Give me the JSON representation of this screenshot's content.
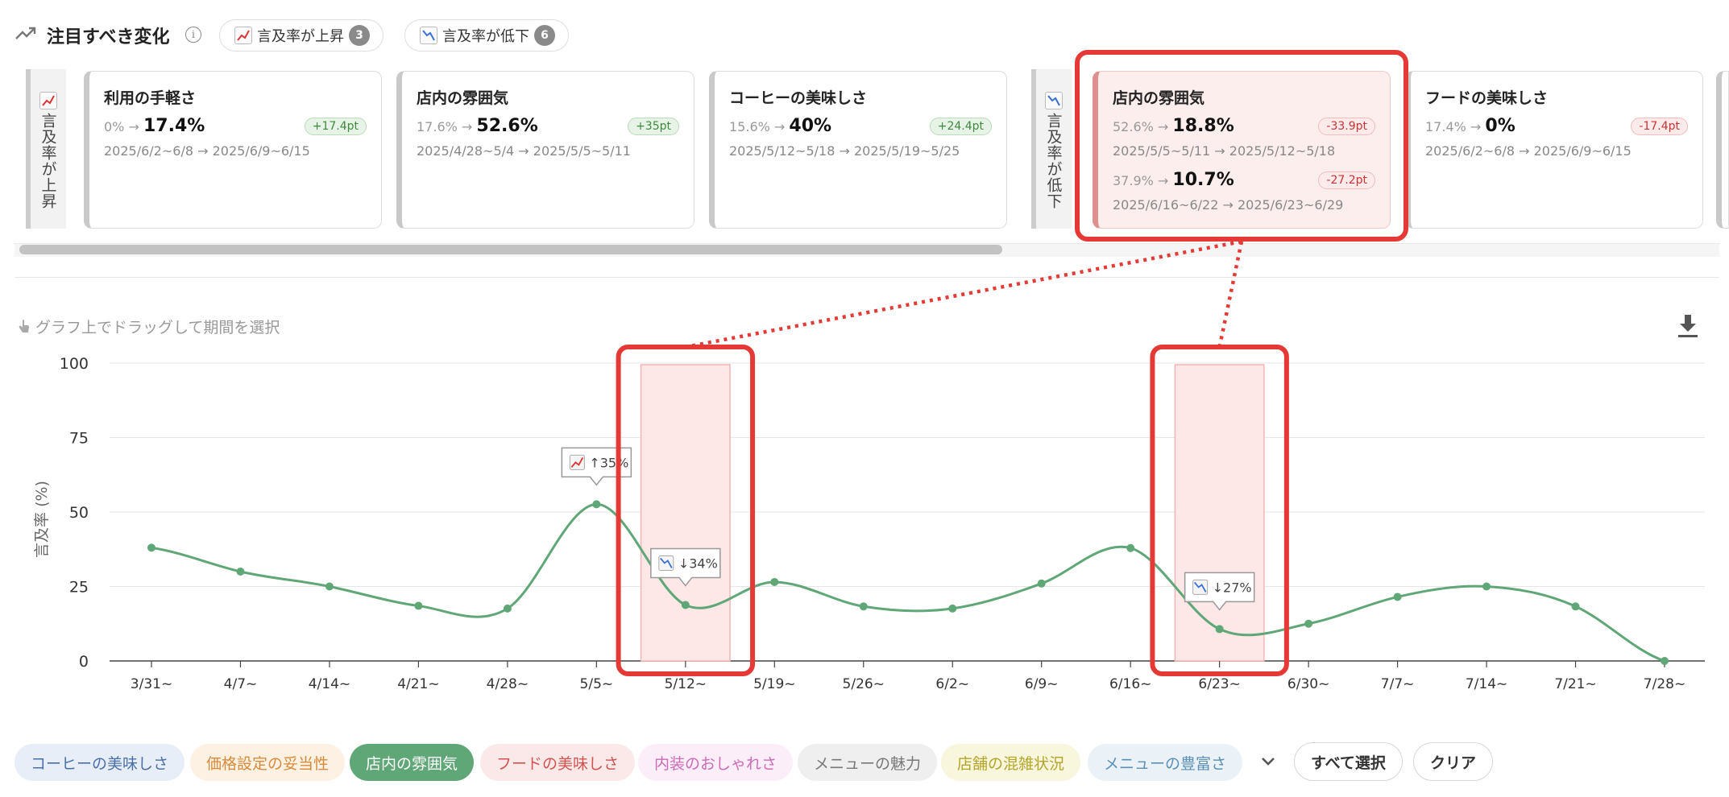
{
  "header": {
    "title": "注目すべき変化",
    "rising_filter": {
      "label": "言及率が上昇",
      "count": "3"
    },
    "falling_filter": {
      "label": "言及率が低下",
      "count": "6"
    }
  },
  "rising_section": {
    "label": "言及率が上昇",
    "cards": [
      {
        "name": "利用の手軽さ",
        "from": "0%",
        "to": "17.4%",
        "delta": "+17.4pt",
        "period": "2025/6/2~6/8 → 2025/6/9~6/15"
      },
      {
        "name": "店内の雰囲気",
        "from": "17.6%",
        "to": "52.6%",
        "delta": "+35pt",
        "period": "2025/4/28~5/4 → 2025/5/5~5/11"
      },
      {
        "name": "コーヒーの美味しさ",
        "from": "15.6%",
        "to": "40%",
        "delta": "+24.4pt",
        "period": "2025/5/12~5/18 → 2025/5/19~5/25"
      }
    ]
  },
  "falling_section": {
    "label": "言及率が低下",
    "cards": [
      {
        "name": "店内の雰囲気",
        "changes": [
          {
            "from": "52.6%",
            "to": "18.8%",
            "delta": "-33.9pt",
            "period": "2025/5/5~5/11 → 2025/5/12~5/18"
          },
          {
            "from": "37.9%",
            "to": "10.7%",
            "delta": "-27.2pt",
            "period": "2025/6/16~6/22 → 2025/6/23~6/29"
          }
        ]
      },
      {
        "name": "フードの美味しさ",
        "from": "17.4%",
        "to": "0%",
        "delta": "-17.4pt",
        "period": "2025/6/2~6/8 → 2025/6/9~6/15"
      }
    ]
  },
  "chart_hint": "グラフ上でドラッグして期間を選択",
  "chart_data": {
    "type": "line",
    "ylabel": "言及率 (%)",
    "ylim": [
      0,
      100
    ],
    "yticks": [
      "0",
      "25",
      "50",
      "75",
      "100"
    ],
    "categories": [
      "3/31~",
      "4/7~",
      "4/14~",
      "4/21~",
      "4/28~",
      "5/5~",
      "5/12~",
      "5/19~",
      "5/26~",
      "6/2~",
      "6/9~",
      "6/16~",
      "6/23~",
      "6/30~",
      "7/7~",
      "7/14~",
      "7/21~",
      "7/28~"
    ],
    "series": [
      {
        "values": [
          38,
          30,
          25,
          18.5,
          17.6,
          52.6,
          18.8,
          26.5,
          18.3,
          17.6,
          26,
          37.9,
          10.7,
          12.5,
          21.5,
          25,
          18.3,
          0
        ]
      }
    ],
    "highlighted_periods": [
      "5/12~",
      "6/23~"
    ],
    "annotations": [
      {
        "at": "5/5~",
        "label": "↑35%"
      },
      {
        "at": "5/12~",
        "label": "↓34%"
      },
      {
        "at": "6/23~",
        "label": "↓27%"
      }
    ],
    "line_color": "#5fa777",
    "grid": true
  },
  "legend_chips": [
    {
      "label": "コーヒーの美味しさ",
      "bg": "#e8eef8",
      "color": "#4a6fa8"
    },
    {
      "label": "価格設定の妥当性",
      "bg": "#fdf1e4",
      "color": "#d98a3a"
    },
    {
      "label": "店内の雰囲気",
      "bg": "#5fa777",
      "color": "#ffffff"
    },
    {
      "label": "フードの美味しさ",
      "bg": "#fbe9e9",
      "color": "#d25252"
    },
    {
      "label": "内装のおしゃれさ",
      "bg": "#fbeef8",
      "color": "#cc6bb8"
    },
    {
      "label": "メニューの魅力",
      "bg": "#efefef",
      "color": "#777777"
    },
    {
      "label": "店舗の混雑状況",
      "bg": "#f8f6dc",
      "color": "#b3a52a"
    },
    {
      "label": "メニューの豊富さ",
      "bg": "#eaf2f8",
      "color": "#5b8fb5"
    }
  ],
  "buttons": {
    "select_all": "すべて選択",
    "clear": "クリア"
  },
  "colors": {
    "highlight_red": "#e53935",
    "rise_green": "#3d8a3d",
    "fall_red": "#cc3333"
  }
}
